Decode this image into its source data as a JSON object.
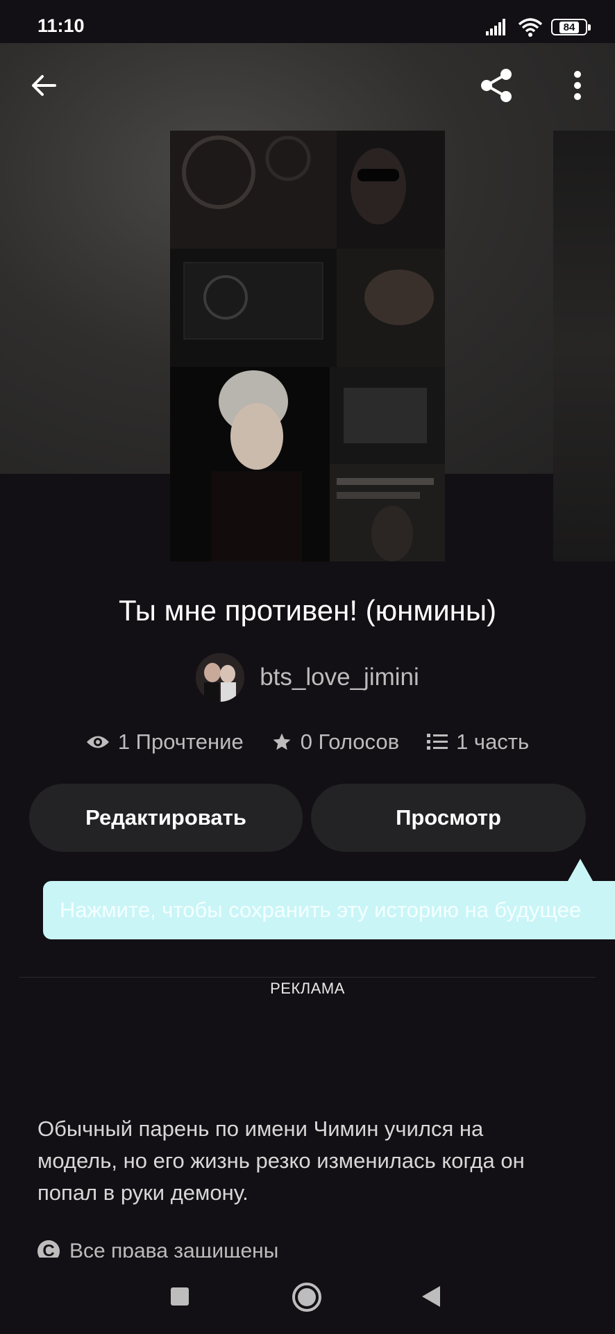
{
  "status_bar": {
    "time": "11:10",
    "battery": "84",
    "icons": [
      "signal-icon",
      "wifi-icon",
      "battery-icon"
    ]
  },
  "top_bar": {
    "icons": [
      "back-arrow-icon",
      "share-icon",
      "more-vertical-icon"
    ]
  },
  "story": {
    "title": "Ты мне противен! (юнмины)",
    "author": "bts_love_jimini",
    "stats": {
      "reads": "1 Прочтение",
      "votes": "0 Голосов",
      "parts": "1 часть"
    },
    "description": "Обычный парень по имени Чимин учился на модель, но его жизнь резко изменилась когда он попал в руки демону.",
    "rights": "Все права защищены"
  },
  "actions": {
    "edit_label": "Редактировать",
    "view_label": "Просмотр"
  },
  "tooltip": {
    "text": "Нажмите, чтобы сохранить эту историю на будущее"
  },
  "ad": {
    "label": "РЕКЛАМА"
  },
  "nav_bar": {
    "icons": [
      "recents-icon",
      "home-icon",
      "back-triangle-icon"
    ]
  },
  "colors": {
    "background": "#121014",
    "button_bg": "#232224",
    "tooltip_bg": "#c9f5f7",
    "muted_text": "#bdbdbd"
  }
}
